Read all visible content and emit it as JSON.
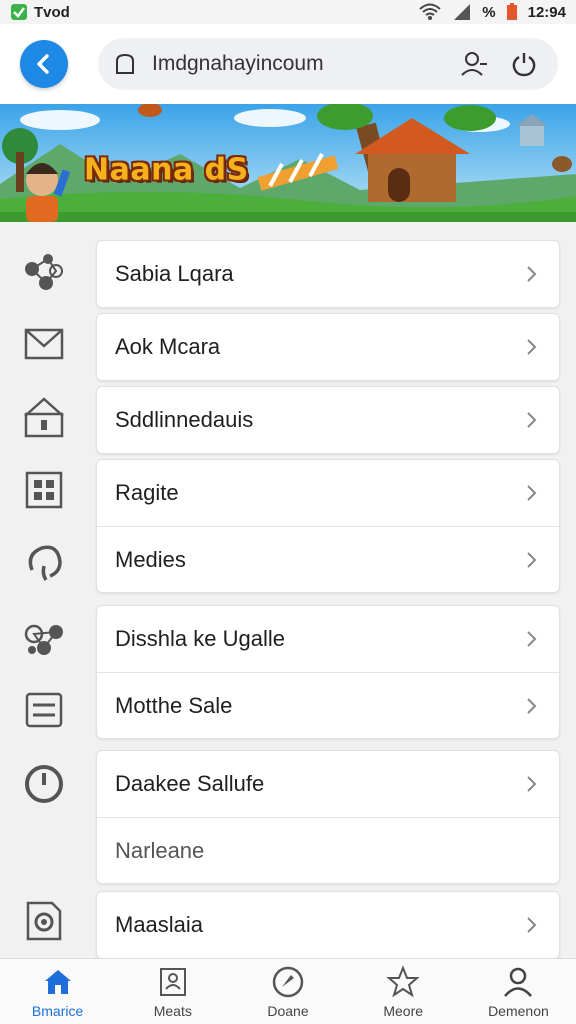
{
  "status_bar": {
    "left_text": "Tvod",
    "battery_text": "%",
    "time": "12:94"
  },
  "address_bar": {
    "url": "Imdgnahayincoum"
  },
  "banner": {
    "title": "Naana dS"
  },
  "menu": {
    "items": [
      {
        "label": "Sabia Lqara",
        "icon": "share-nodes-icon"
      },
      {
        "label": "Aok Mcara",
        "icon": "mail-icon"
      },
      {
        "label": "Sddlinnedauis",
        "icon": "home-outline-icon"
      },
      {
        "label": "Ragite",
        "icon": "grid-icon"
      },
      {
        "label": "Medies",
        "icon": "refresh-arc-icon"
      },
      {
        "label": "Disshla ke Ugalle",
        "icon": "nodes-icon"
      },
      {
        "label": "Motthe Sale",
        "icon": "list-box-icon"
      },
      {
        "label": "Daakee Sallufe",
        "icon": "power-dial-icon"
      },
      {
        "label": "Narleane",
        "icon": ""
      },
      {
        "label": "Maaslaia",
        "icon": "target-doc-icon"
      }
    ]
  },
  "bottom_nav": {
    "items": [
      {
        "label": "Bmarice",
        "icon": "home-icon",
        "active": true
      },
      {
        "label": "Meats",
        "icon": "card-icon",
        "active": false
      },
      {
        "label": "Doane",
        "icon": "compass-icon",
        "active": false
      },
      {
        "label": "Meore",
        "icon": "star-icon",
        "active": false
      },
      {
        "label": "Demenon",
        "icon": "person-icon",
        "active": false
      }
    ]
  },
  "colors": {
    "accent": "#1e88e5",
    "active_nav": "#1e6fd9"
  }
}
